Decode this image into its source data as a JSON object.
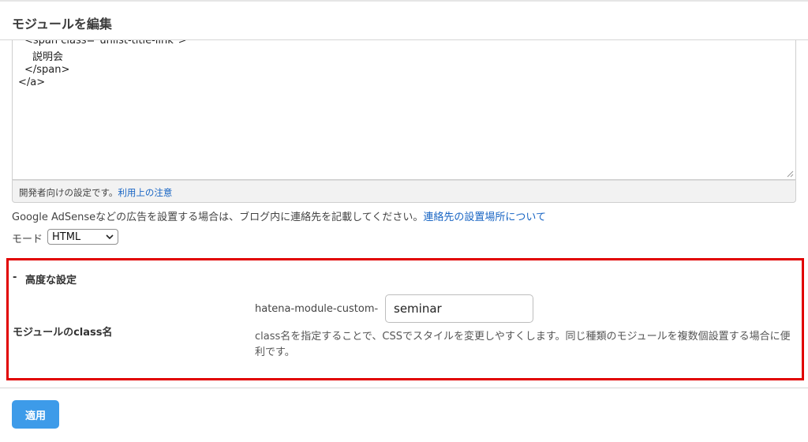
{
  "dialog": {
    "title": "モジュールを編集"
  },
  "code": {
    "lines": [
      "<span class=\"unlist-title-link\">",
      "説明会",
      "</span>",
      "</a>"
    ],
    "footer_note": "開発者向けの設定です。",
    "footer_link": "利用上の注意"
  },
  "adsense": {
    "text": "Google AdSenseなどの広告を設置する場合は、ブログ内に連絡先を記載してください。",
    "link": "連絡先の設置場所について"
  },
  "mode": {
    "label": "モード",
    "selected": "HTML"
  },
  "advanced": {
    "toggle": "-",
    "title": "高度な設定",
    "class_label": "モジュールのclass名",
    "prefix": "hatena-module-custom-",
    "class_value": "seminar",
    "help_text": "class名を指定することで、CSSでスタイルを変更しやすくします。同じ種類のモジュールを複数個設置する場合に便利です。"
  },
  "footer": {
    "apply_label": "適用"
  },
  "colors": {
    "highlight": "#e10000",
    "primary_button": "#3d9be9",
    "link": "#1a66c4"
  }
}
